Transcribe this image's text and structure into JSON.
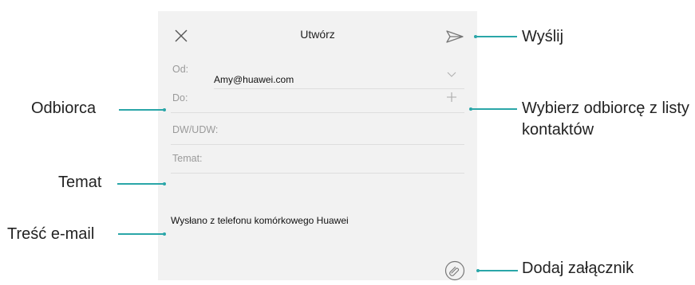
{
  "compose": {
    "title": "Utwórz",
    "from_label": "Od:",
    "from_value": "Amy@huawei.com",
    "to_label": "Do:",
    "cc_label": "DW/UDW:",
    "subject_label": "Temat:",
    "body_text": "Wysłano z telefonu komórkowego Huawei",
    "icons": {
      "close": "close-icon",
      "send": "send-icon",
      "chevron": "chevron-down-icon",
      "add_contact": "plus-icon",
      "attach": "paperclip-icon"
    }
  },
  "callouts": {
    "send": "Wyślij",
    "recipient": "Odbiorca",
    "choose_contact": "Wybierz odbiorcę z listy kontaktów",
    "subject": "Temat",
    "email_body": "Treść e-mail",
    "add_attachment": "Dodaj załącznik"
  },
  "colors": {
    "accent": "#2aa6a8",
    "screen_bg": "#f2f2f2",
    "divider": "#dedede"
  }
}
